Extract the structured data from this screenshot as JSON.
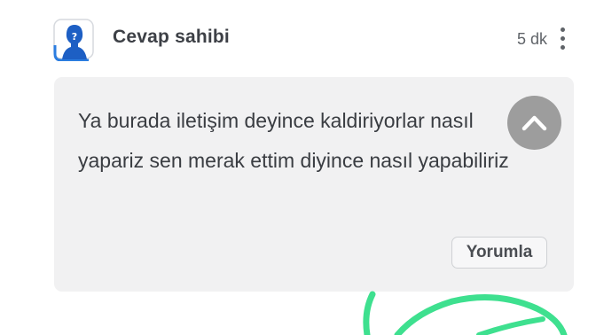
{
  "comment": {
    "author": "Cevap sahibi",
    "time": "5 dk",
    "text": "Ya burada iletişim deyince kaldiriyorlar nasıl yapariz sen merak ettim diyince nasıl yapabiliriz",
    "reply_label": "Yorumla"
  },
  "icons": {
    "avatar": "user-silhouette-question-icon",
    "more": "more-vertical-icon",
    "scroll_up": "chevron-up-icon"
  },
  "colors": {
    "card_background": "#f1f1f2",
    "avatar_blue": "#1d6fd6",
    "scribble_green": "#3ee08f"
  }
}
